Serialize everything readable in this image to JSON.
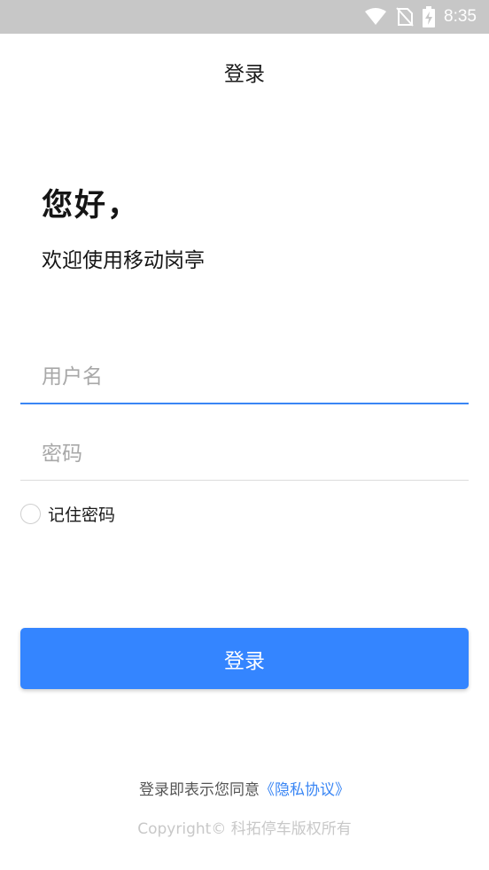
{
  "status_bar": {
    "time": "8:35",
    "icons": [
      "wifi-icon",
      "no-sim-icon",
      "battery-charging-icon"
    ]
  },
  "header": {
    "title": "登录"
  },
  "greeting": {
    "hello": "您好，",
    "welcome": "欢迎使用移动岗亭"
  },
  "form": {
    "username": {
      "value": "",
      "placeholder": "用户名"
    },
    "password": {
      "value": "",
      "placeholder": "密码"
    },
    "remember": {
      "label": "记住密码",
      "checked": false
    }
  },
  "login_button": {
    "label": "登录"
  },
  "footer": {
    "agreement_prefix": "登录即表示您同意",
    "privacy_link": "《隐私协议》",
    "copyright": "Copyright© 科拓停车版权所有"
  },
  "colors": {
    "accent": "#3485ff",
    "link": "#3a86f4",
    "status_bar": "#c7c7c7"
  }
}
